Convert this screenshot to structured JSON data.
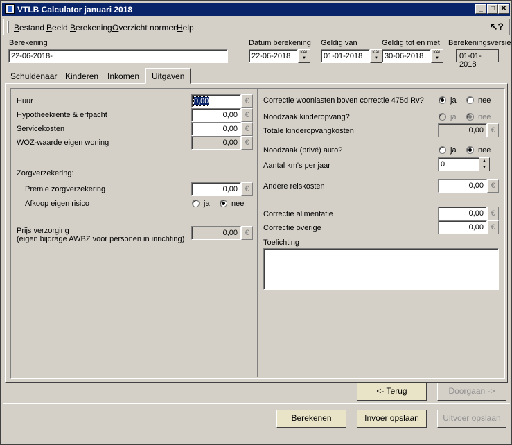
{
  "window": {
    "title": "VTLB Calculator januari 2018"
  },
  "menu": [
    {
      "label": "Bestand",
      "key": "B",
      "rest": "estand"
    },
    {
      "label": "Beeld",
      "key": "B",
      "rest": "eeld"
    },
    {
      "label": "Berekening",
      "key": "B",
      "rest": "erekening"
    },
    {
      "label": "Overzicht normen",
      "key": "O",
      "rest": "verzicht normen"
    },
    {
      "label": "Help",
      "key": "H",
      "rest": "elp"
    }
  ],
  "header": {
    "berekening_label": "Berekening",
    "berekening_value": "22-06-2018-",
    "datum_label": "Datum berekening",
    "datum_value": "22-06-2018",
    "geldig_van_label": "Geldig van",
    "geldig_van_value": "01-01-2018",
    "geldig_tot_label": "Geldig tot en met",
    "geldig_tot_value": "30-06-2018",
    "versie_label": "Berekeningsversie",
    "versie_value": "01-01-2018",
    "cal_label": "KAL"
  },
  "tabs": [
    {
      "label": "Schuldenaar",
      "key": "S",
      "rest": "chuldenaar"
    },
    {
      "label": "Kinderen",
      "key": "K",
      "rest": "inderen"
    },
    {
      "label": "Inkomen",
      "key": "I",
      "rest": "nkomen"
    },
    {
      "label": "Uitgaven",
      "key": "U",
      "rest": "itgaven",
      "active": true
    }
  ],
  "left": {
    "huur_label": "Huur",
    "huur_value": "0,00",
    "hypotheek_label": "Hypotheekrente & erfpacht",
    "hypotheek_value": "0,00",
    "service_label": "Servicekosten",
    "service_value": "0,00",
    "woz_label": "WOZ-waarde eigen woning",
    "woz_value": "0,00",
    "zorg_label": "Zorgverzekering:",
    "premie_label": "Premie zorgverzekering",
    "premie_value": "0,00",
    "afkoop_label": "Afkoop eigen risico",
    "ja": "ja",
    "nee": "nee",
    "prijs_label_1": "Prijs verzorging",
    "prijs_label_2": "(eigen bijdrage AWBZ voor personen in inrichting)",
    "prijs_value": "0,00",
    "currency": "€"
  },
  "right": {
    "correctie_woon_label": "Correctie woonlasten boven correctie 475d Rv?",
    "kinderopvang_label": "Noodzaak kinderopvang?",
    "totale_kinder_label": "Totale kinderopvangkosten",
    "totale_kinder_value": "0,00",
    "auto_label": "Noodzaak (privé) auto?",
    "km_label": "Aantal km's per jaar",
    "km_value": "0",
    "reis_label": "Andere reiskosten",
    "reis_value": "0,00",
    "alimentatie_label": "Correctie alimentatie",
    "alimentatie_value": "0,00",
    "overige_label": "Correctie overige",
    "overige_value": "0,00",
    "toelichting_label": "Toelichting",
    "ja": "ja",
    "nee": "nee"
  },
  "nav": {
    "terug": "<- Terug",
    "doorgaan": "Doorgaan ->"
  },
  "footer": {
    "berekenen": "Berekenen",
    "invoer_opslaan": "Invoer opslaan",
    "uitvoer_opslaan": "Uitvoer opslaan"
  }
}
